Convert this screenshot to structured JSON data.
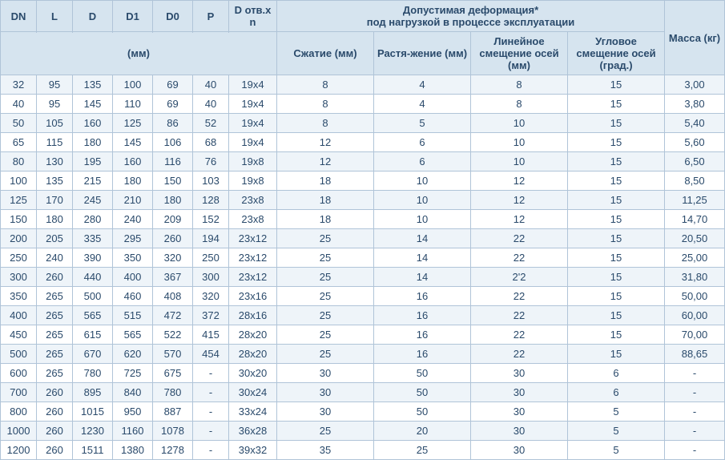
{
  "headers": {
    "dn": "DN",
    "l": "L",
    "d": "D",
    "d1": "D1",
    "d0": "D0",
    "p": "P",
    "dotv": "D отв.х n",
    "deform_group": "Допустимая деформация*\nпод нагрузкой в процессе эксплуатации",
    "mass": "Масса (кг)",
    "mm_unit": "(мм)",
    "szhatie": "Сжатие (мм)",
    "rast": "Растя-жение (мм)",
    "lin": "Линейное смещение осей (мм)",
    "ugl": "Угловое смещение осей (град.)"
  },
  "rows": [
    {
      "dn": "32",
      "l": "95",
      "d": "135",
      "d1": "100",
      "d0": "69",
      "p": "40",
      "dotv": "19х4",
      "sz": "8",
      "ras": "4",
      "lin": "8",
      "ugl": "15",
      "mass": "3,00"
    },
    {
      "dn": "40",
      "l": "95",
      "d": "145",
      "d1": "110",
      "d0": "69",
      "p": "40",
      "dotv": "19х4",
      "sz": "8",
      "ras": "4",
      "lin": "8",
      "ugl": "15",
      "mass": "3,80"
    },
    {
      "dn": "50",
      "l": "105",
      "d": "160",
      "d1": "125",
      "d0": "86",
      "p": "52",
      "dotv": "19х4",
      "sz": "8",
      "ras": "5",
      "lin": "10",
      "ugl": "15",
      "mass": "5,40"
    },
    {
      "dn": "65",
      "l": "115",
      "d": "180",
      "d1": "145",
      "d0": "106",
      "p": "68",
      "dotv": "19х4",
      "sz": "12",
      "ras": "6",
      "lin": "10",
      "ugl": "15",
      "mass": "5,60"
    },
    {
      "dn": "80",
      "l": "130",
      "d": "195",
      "d1": "160",
      "d0": "116",
      "p": "76",
      "dotv": "19х8",
      "sz": "12",
      "ras": "6",
      "lin": "10",
      "ugl": "15",
      "mass": "6,50"
    },
    {
      "dn": "100",
      "l": "135",
      "d": "215",
      "d1": "180",
      "d0": "150",
      "p": "103",
      "dotv": "19х8",
      "sz": "18",
      "ras": "10",
      "lin": "12",
      "ugl": "15",
      "mass": "8,50"
    },
    {
      "dn": "125",
      "l": "170",
      "d": "245",
      "d1": "210",
      "d0": "180",
      "p": "128",
      "dotv": "23х8",
      "sz": "18",
      "ras": "10",
      "lin": "12",
      "ugl": "15",
      "mass": "11,25"
    },
    {
      "dn": "150",
      "l": "180",
      "d": "280",
      "d1": "240",
      "d0": "209",
      "p": "152",
      "dotv": "23х8",
      "sz": "18",
      "ras": "10",
      "lin": "12",
      "ugl": "15",
      "mass": "14,70"
    },
    {
      "dn": "200",
      "l": "205",
      "d": "335",
      "d1": "295",
      "d0": "260",
      "p": "194",
      "dotv": "23х12",
      "sz": "25",
      "ras": "14",
      "lin": "22",
      "ugl": "15",
      "mass": "20,50"
    },
    {
      "dn": "250",
      "l": "240",
      "d": "390",
      "d1": "350",
      "d0": "320",
      "p": "250",
      "dotv": "23х12",
      "sz": "25",
      "ras": "14",
      "lin": "22",
      "ugl": "15",
      "mass": "25,00"
    },
    {
      "dn": "300",
      "l": "260",
      "d": "440",
      "d1": "400",
      "d0": "367",
      "p": "300",
      "dotv": "23х12",
      "sz": "25",
      "ras": "14",
      "lin": "2'2",
      "ugl": "15",
      "mass": "31,80"
    },
    {
      "dn": "350",
      "l": "265",
      "d": "500",
      "d1": "460",
      "d0": "408",
      "p": "320",
      "dotv": "23х16",
      "sz": "25",
      "ras": "16",
      "lin": "22",
      "ugl": "15",
      "mass": "50,00"
    },
    {
      "dn": "400",
      "l": "265",
      "d": "565",
      "d1": "515",
      "d0": "472",
      "p": "372",
      "dotv": "28х16",
      "sz": "25",
      "ras": "16",
      "lin": "22",
      "ugl": "15",
      "mass": "60,00"
    },
    {
      "dn": "450",
      "l": "265",
      "d": "615",
      "d1": "565",
      "d0": "522",
      "p": "415",
      "dotv": "28х20",
      "sz": "25",
      "ras": "16",
      "lin": "22",
      "ugl": "15",
      "mass": "70,00"
    },
    {
      "dn": "500",
      "l": "265",
      "d": "670",
      "d1": "620",
      "d0": "570",
      "p": "454",
      "dotv": "28х20",
      "sz": "25",
      "ras": "16",
      "lin": "22",
      "ugl": "15",
      "mass": "88,65"
    },
    {
      "dn": "600",
      "l": "265",
      "d": "780",
      "d1": "725",
      "d0": "675",
      "p": "-",
      "dotv": "30х20",
      "sz": "30",
      "ras": "50",
      "lin": "30",
      "ugl": "6",
      "mass": "-"
    },
    {
      "dn": "700",
      "l": "260",
      "d": "895",
      "d1": "840",
      "d0": "780",
      "p": "-",
      "dotv": "30х24",
      "sz": "30",
      "ras": "50",
      "lin": "30",
      "ugl": "6",
      "mass": "-"
    },
    {
      "dn": "800",
      "l": "260",
      "d": "1015",
      "d1": "950",
      "d0": "887",
      "p": "-",
      "dotv": "33х24",
      "sz": "30",
      "ras": "50",
      "lin": "30",
      "ugl": "5",
      "mass": "-"
    },
    {
      "dn": "1000",
      "l": "260",
      "d": "1230",
      "d1": "1160",
      "d0": "1078",
      "p": "-",
      "dotv": "36х28",
      "sz": "25",
      "ras": "20",
      "lin": "30",
      "ugl": "5",
      "mass": "-"
    },
    {
      "dn": "1200",
      "l": "260",
      "d": "1511",
      "d1": "1380",
      "d0": "1278",
      "p": "-",
      "dotv": "39х32",
      "sz": "35",
      "ras": "25",
      "lin": "30",
      "ugl": "5",
      "mass": "-"
    }
  ]
}
